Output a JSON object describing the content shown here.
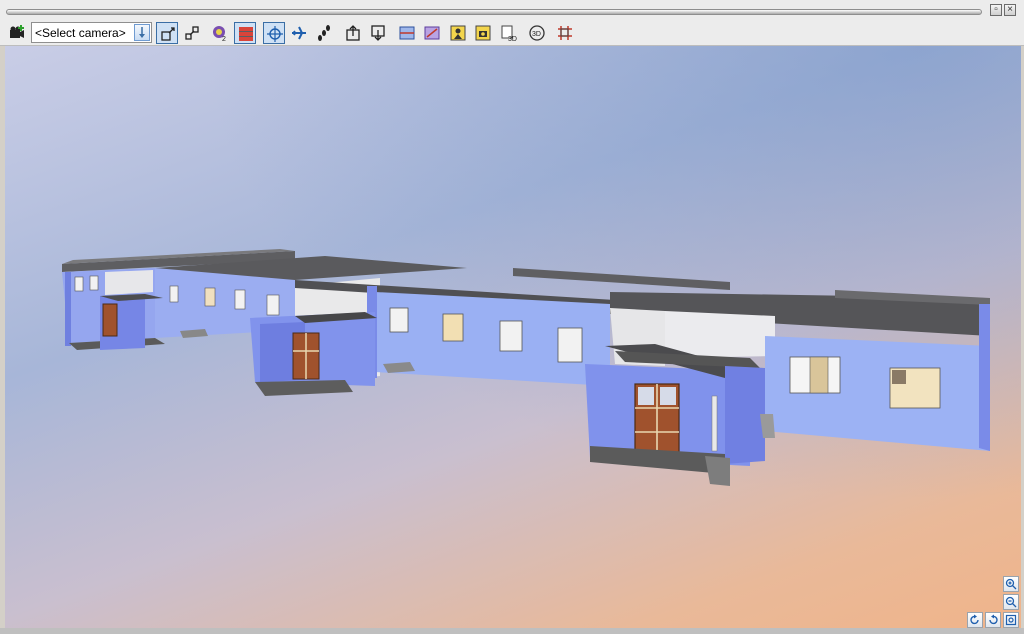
{
  "toolbar": {
    "camera_select": {
      "value": "<Select camera>"
    }
  },
  "icons": [
    "add-camera-icon",
    "camera-dropdown-icon",
    "view-mode-a-icon",
    "view-mode-b-icon",
    "render-style-icon",
    "wall-layers-icon",
    "orbit-icon",
    "fly-icon",
    "walk-icon",
    "level-up-icon",
    "level-down-icon",
    "section-icon",
    "section-b-icon",
    "visitor-icon",
    "snapshot-icon",
    "export-3d-icon",
    "rotate-3d-icon",
    "grid-frame-icon",
    "zoom-in-icon",
    "zoom-out-icon",
    "rotate-left-icon",
    "rotate-right-icon",
    "zoom-extents-icon"
  ],
  "colors": {
    "accent": "#3a6ea5",
    "wall": "#8fa2ec",
    "roof": "#5a5a5c"
  }
}
